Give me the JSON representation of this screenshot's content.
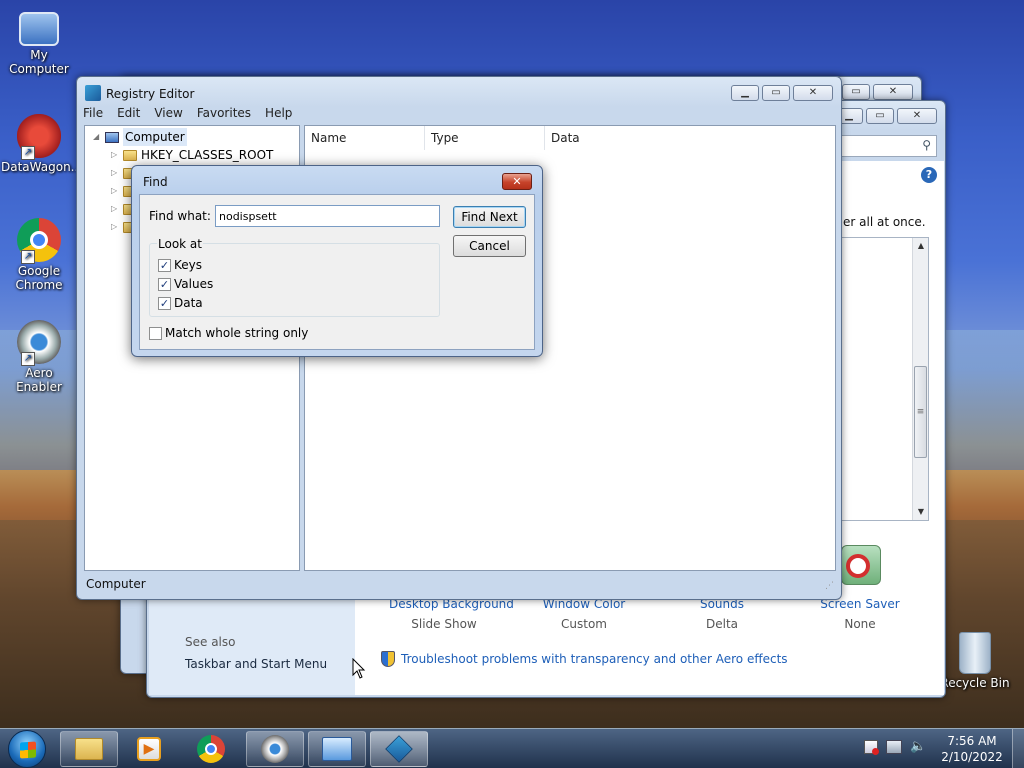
{
  "desktop": {
    "icons": [
      {
        "label": "My Computer"
      },
      {
        "label": "DataWagon..."
      },
      {
        "label": "Google Chrome"
      },
      {
        "label": "Aero Enabler"
      },
      {
        "label": "Recycle Bin"
      }
    ]
  },
  "personalization": {
    "right_text": "er all at once.",
    "themes": [
      {
        "label": "Desktop Background",
        "value": "Slide Show"
      },
      {
        "label": "Window Color",
        "value": "Custom"
      },
      {
        "label": "Sounds",
        "value": "Delta"
      },
      {
        "label": "Screen Saver",
        "value": "None"
      }
    ],
    "see_also": "See also",
    "see_also_link": "Taskbar and Start Menu",
    "troubleshoot_link": "Troubleshoot problems with transparency and other Aero effects"
  },
  "regedit": {
    "title": "Registry Editor",
    "menu": [
      "File",
      "Edit",
      "View",
      "Favorites",
      "Help"
    ],
    "tree_root": "Computer",
    "tree_items": [
      "HKEY_CLASSES_ROOT"
    ],
    "columns": [
      "Name",
      "Type",
      "Data"
    ],
    "status": "Computer"
  },
  "find_dialog": {
    "title": "Find",
    "find_what_label": "Find what:",
    "find_what_value": "nodispsett",
    "find_next_label": "Find Next",
    "cancel_label": "Cancel",
    "look_at_label": "Look at",
    "options": [
      {
        "label": "Keys",
        "checked": true
      },
      {
        "label": "Values",
        "checked": true
      },
      {
        "label": "Data",
        "checked": true
      }
    ],
    "match_whole_label": "Match whole string only",
    "match_whole_checked": false
  },
  "taskbar": {
    "time": "7:56 AM",
    "date": "2/10/2022"
  },
  "colors": {
    "link": "#1e5fb8",
    "title_bar": "#c9dbf2",
    "taskbar": "#2d4a72"
  }
}
